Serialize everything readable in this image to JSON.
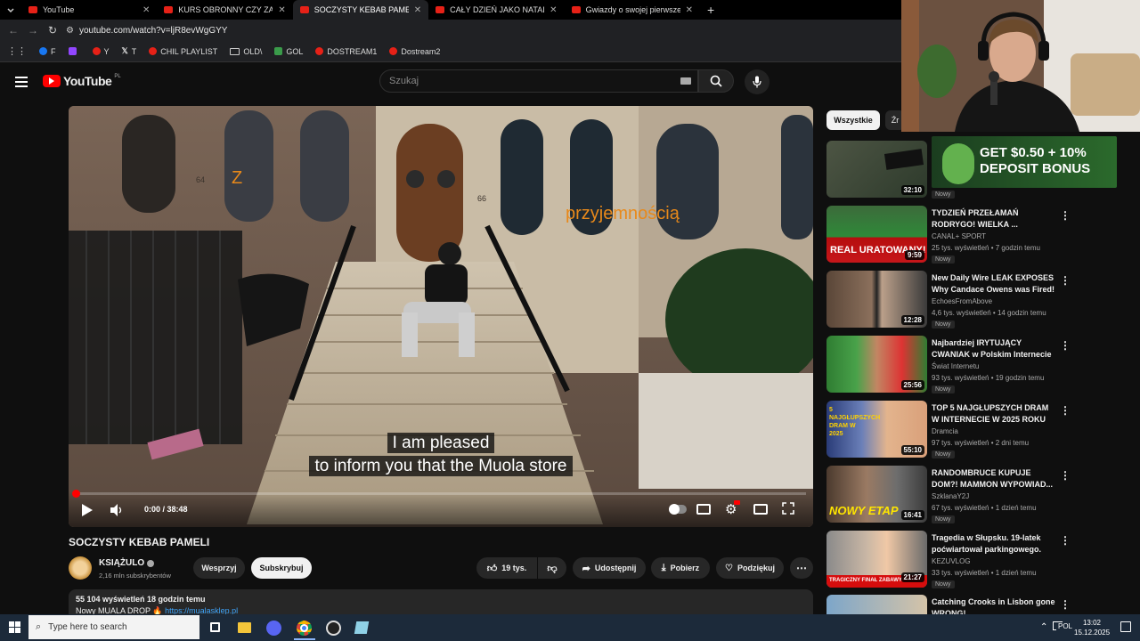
{
  "browser": {
    "tabs": [
      {
        "label": "YouTube",
        "active": false
      },
      {
        "label": "KURS OBRONNY CZY ZABAWA",
        "active": false
      },
      {
        "label": "SOCZYSTY KEBAB PAMELI - You",
        "active": true
      },
      {
        "label": "CAŁY DZIEŃ JAKO NATALKA!! (",
        "active": false
      },
      {
        "label": "Gwiazdy o swojej pierwszej pra",
        "active": false
      }
    ],
    "new_tab": "+",
    "url": "youtube.com/watch?v=ljR8evWgGYY",
    "bookmarks": [
      "F",
      "",
      "Y",
      "T",
      "CHIL PLAYLIST",
      "OLD\\",
      "GOL",
      "DOSTREAM1",
      "Dostream2"
    ]
  },
  "header": {
    "logo": "YouTube",
    "region": "PL",
    "search_placeholder": "Szukaj"
  },
  "video": {
    "overlay_z": "Z",
    "overlay_text": "przyjemnością",
    "house_number_left": "64",
    "house_number_right": "66",
    "subtitle_line1": "I am pleased",
    "subtitle_line2": "to inform you that the Muola store",
    "time": "0:00 / 38:48",
    "progress": 0.0
  },
  "details": {
    "title": "SOCZYSTY KEBAB PAMELI",
    "channel": "KSIĄŻULO",
    "subscribers": "2,16 mln subskrybentów",
    "support_label": "Wesprzyj",
    "subscribe_label": "Subskrybuj",
    "likes": "19 tys.",
    "share_label": "Udostępnij",
    "download_label": "Pobierz",
    "thanks_label": "Podziękuj",
    "views_line": "55 104 wyświetleń  18 godzin temu",
    "desc_line": "Nowy MUALA DROP 🔥",
    "desc_link": "https://mualasklep.pl"
  },
  "sidebar": {
    "chips": [
      "Wszystkie",
      "Źr"
    ],
    "ad": {
      "text1": "GET $0.50 + 10%",
      "text2": "DEPOSIT BONUS",
      "badge": "Nowy",
      "duration": "32:10"
    },
    "videos": [
      {
        "title": "TYDZIEŃ PRZEŁAMAŃ RODRYGO! WIELKA ...",
        "channel": "CANAL+ SPORT",
        "meta": "25 tys. wyświetleń • 7 godzin temu",
        "badge": "Nowy",
        "duration": "9:59",
        "thumb_text": "REAL URATOWANY!"
      },
      {
        "title": "New Daily Wire LEAK EXPOSES Why Candace Owens was Fired!",
        "channel": "EchoesFromAbove",
        "meta": "4,6 tys. wyświetleń • 14 godzin temu",
        "badge": "Nowy",
        "duration": "12:28",
        "thumb_text": ""
      },
      {
        "title": "Najbardziej IRYTUJĄCY CWANIAK w Polskim Internecie",
        "channel": "Świat Internetu",
        "meta": "93 tys. wyświetleń • 19 godzin temu",
        "badge": "Nowy",
        "duration": "25:56",
        "thumb_text": ""
      },
      {
        "title": "TOP 5 NAJGŁUPSZYCH DRAM W INTERNECIE W 2025 ROKU",
        "channel": "Dramcia",
        "meta": "97 tys. wyświetleń • 2 dni temu",
        "badge": "Nowy",
        "duration": "55:10",
        "thumb_text": "5 NAJGŁUPSZYCH DRAM W 2025"
      },
      {
        "title": "RANDOMBRUCE KUPUJE DOM?! MAMMON WYPOWIAD...",
        "channel": "SzklanaY2J",
        "meta": "67 tys. wyświetleń • 1 dzień temu",
        "badge": "Nowy",
        "duration": "16:41",
        "thumb_text": "NOWY ETAP"
      },
      {
        "title": "Tragedia w Słupsku. 19-latek poćwiartował parkingowego.",
        "channel": "KEZUVLOG",
        "meta": "33 tys. wyświetleń • 1 dzień temu",
        "badge": "Nowy",
        "duration": "21:27",
        "thumb_text": "TRAGICZNY FINAŁ ZABAWY"
      },
      {
        "title": "Catching Crooks in Lisbon gone WRONG!",
        "channel": "",
        "meta": "",
        "badge": "",
        "duration": "",
        "thumb_text": ""
      }
    ]
  },
  "taskbar": {
    "search_placeholder": "Type here to search",
    "language": "POL",
    "time": "13:02",
    "date": "15.12.2025"
  },
  "colors": {
    "yt_red": "#ff0000",
    "bg": "#0f0f0f",
    "taskbar": "#1c2a3a",
    "overlay_orange": "#e8891a"
  }
}
